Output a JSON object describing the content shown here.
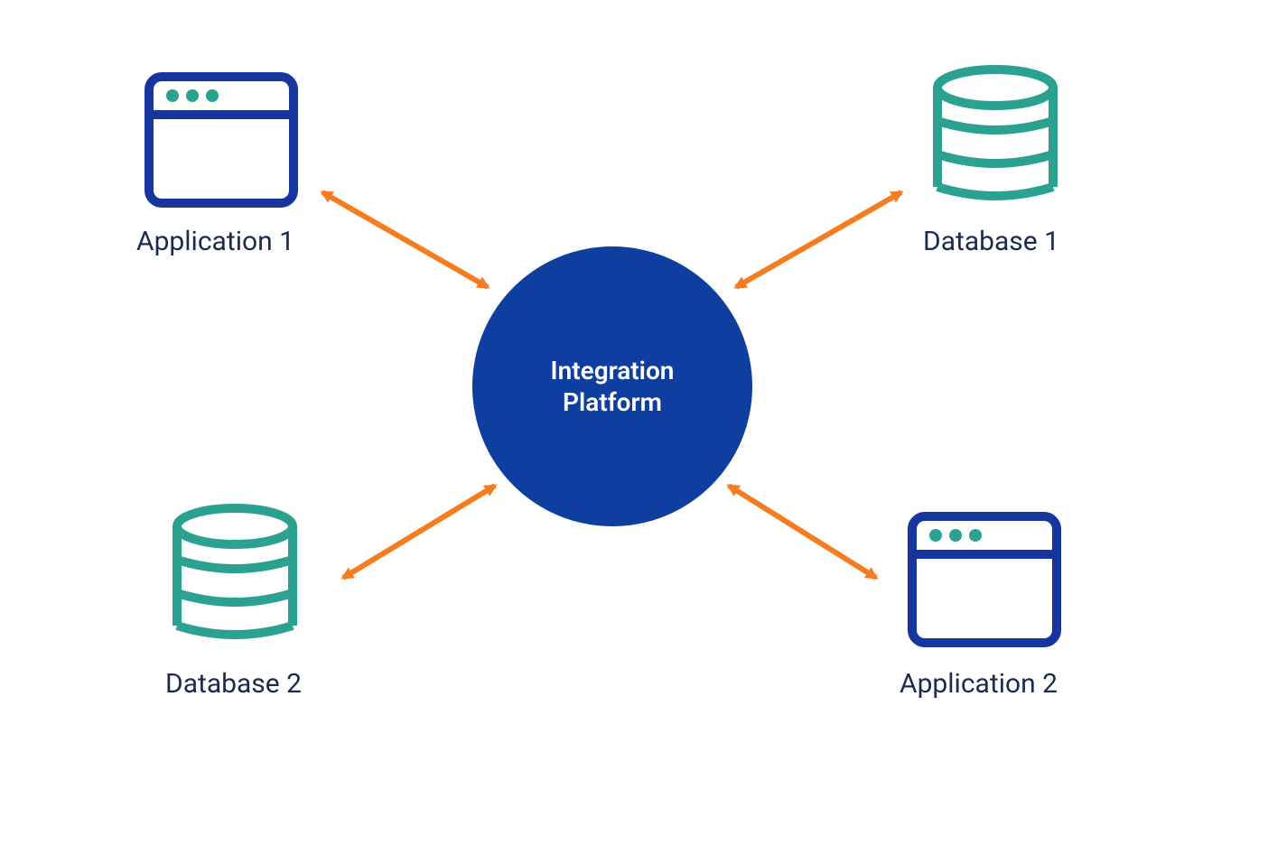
{
  "diagram": {
    "center": {
      "line1": "Integration",
      "line2": "Platform"
    },
    "nodes": {
      "topLeft": {
        "label": "Application 1",
        "type": "application"
      },
      "topRight": {
        "label": "Database 1",
        "type": "database"
      },
      "bottomLeft": {
        "label": "Database 2",
        "type": "database"
      },
      "bottomRight": {
        "label": "Application 2",
        "type": "application"
      }
    },
    "colors": {
      "centerFill": "#0d3ea0",
      "appStroke": "#17359e",
      "dbStroke": "#2aa28f",
      "dotFill": "#2aa28f",
      "arrow": "#f57c1f",
      "labelText": "#1b2a4e",
      "centerText": "#ffffff"
    },
    "connections": [
      {
        "from": "topLeft",
        "to": "center",
        "bidirectional": true
      },
      {
        "from": "topRight",
        "to": "center",
        "bidirectional": true
      },
      {
        "from": "bottomLeft",
        "to": "center",
        "bidirectional": true
      },
      {
        "from": "bottomRight",
        "to": "center",
        "bidirectional": true
      }
    ]
  }
}
